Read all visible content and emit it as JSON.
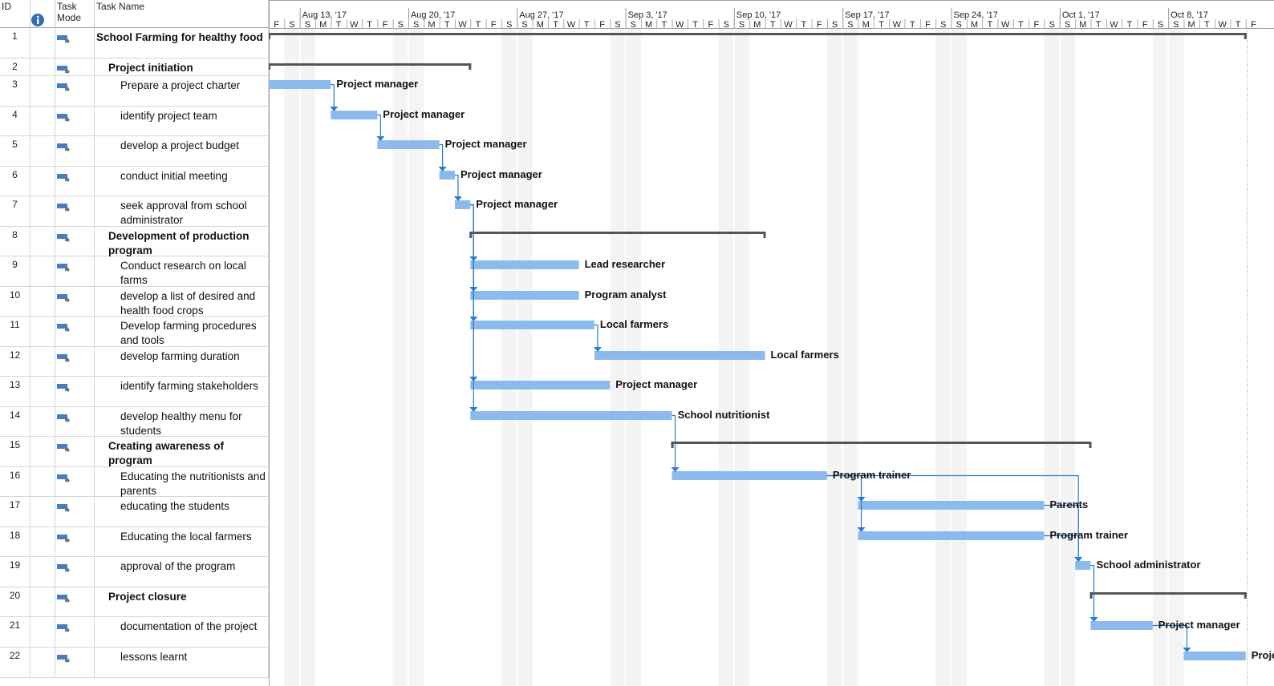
{
  "table": {
    "headers": {
      "id": "ID",
      "info_icon": "info-icon",
      "mode": "Task\nMode",
      "name": "Task Name"
    }
  },
  "timescale": {
    "first_day": "2017-08-11",
    "weeks": [
      {
        "label": "Aug 13, '17",
        "date": "2017-08-13"
      },
      {
        "label": "Aug 20, '17",
        "date": "2017-08-20"
      },
      {
        "label": "Aug 27, '17",
        "date": "2017-08-27"
      },
      {
        "label": "Sep 3, '17",
        "date": "2017-09-03"
      },
      {
        "label": "Sep 10, '17",
        "date": "2017-09-10"
      },
      {
        "label": "Sep 17, '17",
        "date": "2017-09-17"
      },
      {
        "label": "Sep 24, '17",
        "date": "2017-09-24"
      },
      {
        "label": "Oct 1, '17",
        "date": "2017-10-01"
      },
      {
        "label": "Oct 8, '17",
        "date": "2017-10-08"
      }
    ],
    "day_letters": [
      "F",
      "S",
      "S",
      "M",
      "T",
      "W",
      "T",
      "F",
      "S",
      "S",
      "M",
      "T",
      "W",
      "T",
      "F",
      "S",
      "S",
      "M",
      "T",
      "W",
      "T",
      "F",
      "S",
      "S",
      "M",
      "T",
      "W",
      "T",
      "F",
      "S",
      "S",
      "M",
      "T",
      "W",
      "T",
      "F",
      "S",
      "S",
      "M",
      "T",
      "W",
      "T",
      "F",
      "S",
      "S",
      "M",
      "T",
      "W",
      "T",
      "F",
      "S",
      "S",
      "M",
      "T",
      "W",
      "T",
      "F",
      "S",
      "S",
      "M",
      "T",
      "W",
      "T",
      "F"
    ]
  },
  "colors": {
    "task_bar": "#8cbbeb",
    "link": "#2b7bd3",
    "summary": "#555555",
    "weekend": "#f4f4f4"
  },
  "tasks": [
    {
      "id": "1",
      "name": "School Farming for healthy food",
      "level": 0,
      "summary": true,
      "start": "2017-08-11",
      "finish": "2017-10-12",
      "resource": "",
      "preds": []
    },
    {
      "id": "2",
      "name": "Project initiation",
      "level": 1,
      "summary": true,
      "start": "2017-08-11",
      "finish": "2017-08-23",
      "resource": "",
      "preds": []
    },
    {
      "id": "3",
      "name": "Prepare a project charter",
      "level": 2,
      "summary": false,
      "start": "2017-08-11",
      "finish": "2017-08-14",
      "resource": "Project manager",
      "preds": []
    },
    {
      "id": "4",
      "name": "identify project team",
      "level": 2,
      "summary": false,
      "start": "2017-08-15",
      "finish": "2017-08-17",
      "resource": "Project manager",
      "preds": [
        "3"
      ]
    },
    {
      "id": "5",
      "name": "develop a project budget",
      "level": 2,
      "summary": false,
      "start": "2017-08-18",
      "finish": "2017-08-21",
      "resource": "Project manager",
      "preds": [
        "4"
      ]
    },
    {
      "id": "6",
      "name": "conduct initial meeting",
      "level": 2,
      "summary": false,
      "start": "2017-08-22",
      "finish": "2017-08-22",
      "resource": "Project manager",
      "preds": [
        "5"
      ]
    },
    {
      "id": "7",
      "name": "seek approval from school administrator",
      "level": 2,
      "summary": false,
      "start": "2017-08-23",
      "finish": "2017-08-23",
      "resource": "Project manager",
      "preds": [
        "6"
      ]
    },
    {
      "id": "8",
      "name": "Development of production program",
      "level": 1,
      "summary": true,
      "start": "2017-08-24",
      "finish": "2017-09-11",
      "resource": "",
      "preds": []
    },
    {
      "id": "9",
      "name": "Conduct research on local farms",
      "level": 2,
      "summary": false,
      "start": "2017-08-24",
      "finish": "2017-08-30",
      "resource": "Lead researcher",
      "preds": [
        "7"
      ]
    },
    {
      "id": "10",
      "name": "develop a list of desired and health food crops",
      "level": 2,
      "summary": false,
      "start": "2017-08-24",
      "finish": "2017-08-30",
      "resource": "Program analyst",
      "preds": [
        "7"
      ]
    },
    {
      "id": "11",
      "name": "Develop farming procedures and tools",
      "level": 2,
      "summary": false,
      "start": "2017-08-24",
      "finish": "2017-08-31",
      "resource": "Local farmers",
      "preds": [
        "7"
      ]
    },
    {
      "id": "12",
      "name": "develop farming duration",
      "level": 2,
      "summary": false,
      "start": "2017-09-01",
      "finish": "2017-09-11",
      "resource": "Local farmers",
      "preds": [
        "11"
      ]
    },
    {
      "id": "13",
      "name": "identify farming stakeholders",
      "level": 2,
      "summary": false,
      "start": "2017-08-24",
      "finish": "2017-09-01",
      "resource": "Project manager",
      "preds": [
        "7"
      ]
    },
    {
      "id": "14",
      "name": "develop  healthy menu for students",
      "level": 2,
      "summary": false,
      "start": "2017-08-24",
      "finish": "2017-09-05",
      "resource": "School nutritionist",
      "preds": [
        "7"
      ]
    },
    {
      "id": "15",
      "name": "Creating awareness of program",
      "level": 1,
      "summary": true,
      "start": "2017-09-06",
      "finish": "2017-10-02",
      "resource": "",
      "preds": []
    },
    {
      "id": "16",
      "name": "Educating the nutritionists and parents",
      "level": 2,
      "summary": false,
      "start": "2017-09-06",
      "finish": "2017-09-15",
      "resource": "Program trainer",
      "preds": [
        "14"
      ]
    },
    {
      "id": "17",
      "name": "educating the students",
      "level": 2,
      "summary": false,
      "start": "2017-09-18",
      "finish": "2017-09-29",
      "resource": "Parents",
      "preds": [
        "16"
      ]
    },
    {
      "id": "18",
      "name": "Educating the local farmers",
      "level": 2,
      "summary": false,
      "start": "2017-09-18",
      "finish": "2017-09-29",
      "resource": "Program trainer",
      "preds": [
        "16"
      ]
    },
    {
      "id": "19",
      "name": "approval of the program",
      "level": 2,
      "summary": false,
      "start": "2017-10-02",
      "finish": "2017-10-02",
      "resource": "School administrator",
      "preds": [
        "16",
        "17",
        "18"
      ]
    },
    {
      "id": "20",
      "name": "Project closure",
      "level": 1,
      "summary": true,
      "start": "2017-10-03",
      "finish": "2017-10-12",
      "resource": "",
      "preds": []
    },
    {
      "id": "21",
      "name": "documentation of the project",
      "level": 2,
      "summary": false,
      "start": "2017-10-03",
      "finish": "2017-10-06",
      "resource": "Project manager",
      "preds": [
        "19"
      ]
    },
    {
      "id": "22",
      "name": "lessons learnt",
      "level": 2,
      "summary": false,
      "start": "2017-10-09",
      "finish": "2017-10-12",
      "resource": "Project manager",
      "preds": [
        "21"
      ]
    }
  ]
}
